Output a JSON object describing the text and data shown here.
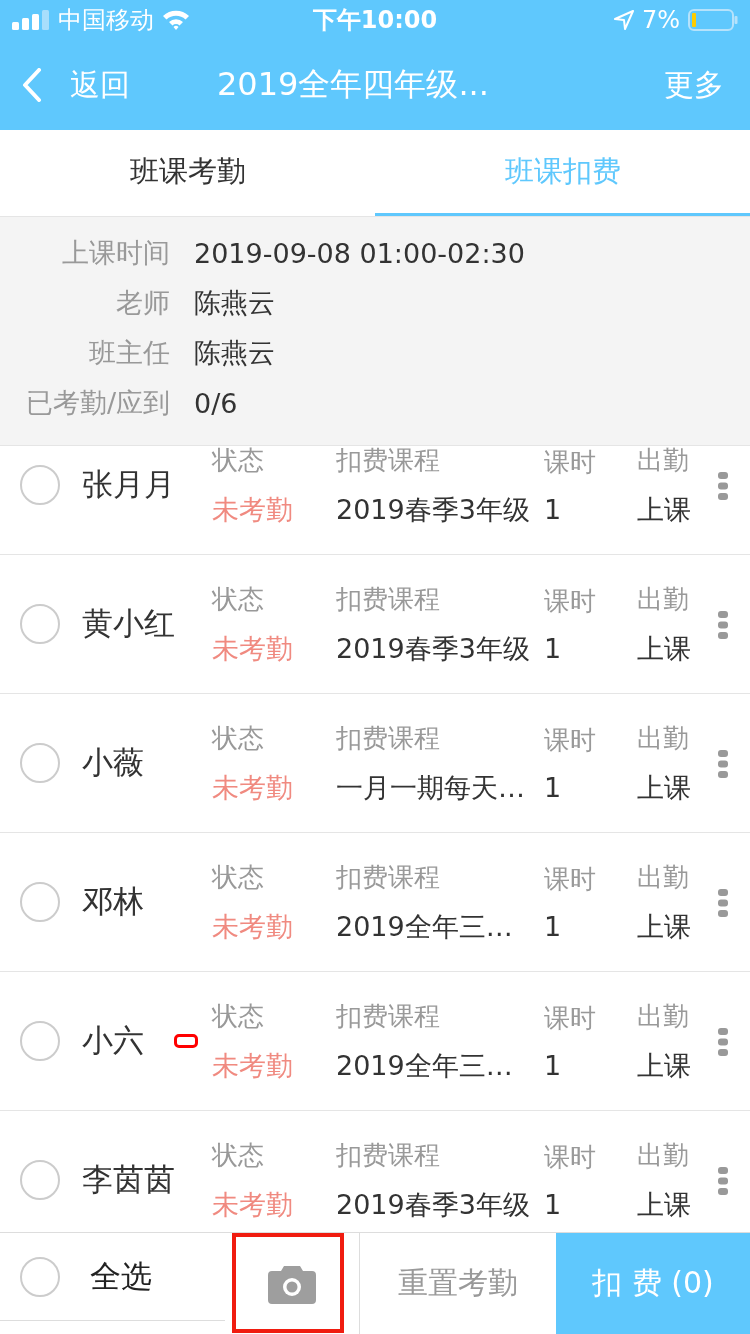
{
  "status_bar": {
    "carrier": "中国移动",
    "time": "下午10:00",
    "battery": "7%"
  },
  "nav": {
    "back": "返回",
    "title": "2019全年四年级...",
    "more": "更多"
  },
  "tabs": [
    {
      "label": "班课考勤",
      "selected": false
    },
    {
      "label": "班课扣费",
      "selected": true
    }
  ],
  "info": [
    {
      "label": "上课时间",
      "value": "2019-09-08 01:00-02:30"
    },
    {
      "label": "老师",
      "value": "陈燕云"
    },
    {
      "label": "班主任",
      "value": "陈燕云"
    },
    {
      "label": "已考勤/应到",
      "value": "0/6"
    }
  ],
  "students": [
    {
      "name": "张月月",
      "checked": false,
      "marked": false,
      "labels": [
        "状态",
        "扣费课程",
        "课时",
        "出勤"
      ],
      "status": "未考勤",
      "course": "2019春季3年级",
      "hours": "1",
      "attendance": "上课"
    },
    {
      "name": "黄小红",
      "checked": false,
      "marked": false,
      "labels": [
        "状态",
        "扣费课程",
        "课时",
        "出勤"
      ],
      "status": "未考勤",
      "course": "2019春季3年级",
      "hours": "1",
      "attendance": "上课"
    },
    {
      "name": "小薇",
      "checked": false,
      "marked": false,
      "labels": [
        "状态",
        "扣费课程",
        "课时",
        "出勤"
      ],
      "status": "未考勤",
      "course": "一月一期每天…",
      "hours": "1",
      "attendance": "上课"
    },
    {
      "name": "邓林",
      "checked": false,
      "marked": false,
      "labels": [
        "状态",
        "扣费课程",
        "课时",
        "出勤"
      ],
      "status": "未考勤",
      "course": "2019全年三…",
      "hours": "1",
      "attendance": "上课"
    },
    {
      "name": "小六",
      "checked": false,
      "marked": true,
      "labels": [
        "状态",
        "扣费课程",
        "课时",
        "出勤"
      ],
      "status": "未考勤",
      "course": "2019全年三…",
      "hours": "1",
      "attendance": "上课"
    },
    {
      "name": "李茵茵",
      "checked": false,
      "marked": false,
      "labels": [
        "状态",
        "扣费课程",
        "课时",
        "出勤"
      ],
      "status": "未考勤",
      "course": "2019春季3年级",
      "hours": "1",
      "attendance": "上课"
    }
  ],
  "footer": {
    "select_all": "全选",
    "select_all_checked": false,
    "camera_highlighted": true,
    "reset": "重置考勤",
    "charge": "扣 费 (0)"
  }
}
